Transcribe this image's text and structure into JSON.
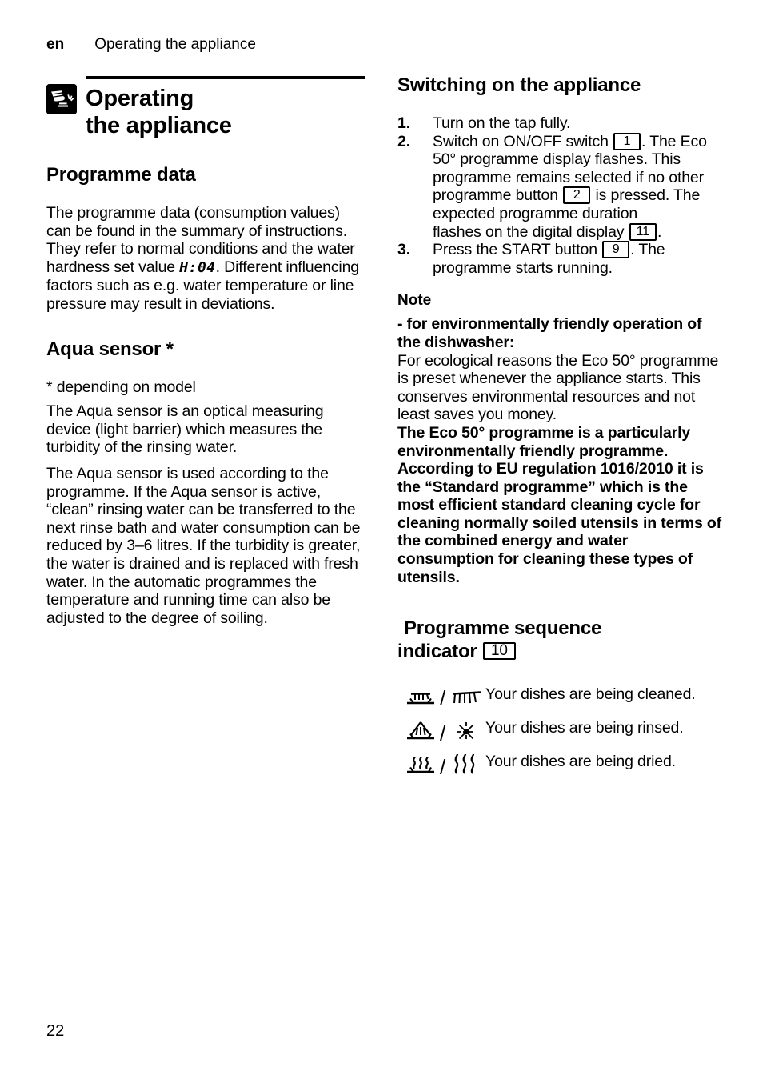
{
  "running_head": {
    "lang": "en",
    "title": "Operating the appliance"
  },
  "chapter": {
    "icon": "hand-pressing-button-icon",
    "title_line1": "Operating",
    "title_line2": "the appliance"
  },
  "left_column": {
    "programme_data": {
      "heading": "Programme data",
      "paragraph_part1": "The programme data (consumption values) can be found in the summary of instructions. They refer to normal conditions and the water hardness set value ",
      "hardness_value": "H:04",
      "paragraph_part2": ". Different influencing factors such as e.g. water temperature or line pressure may result in deviations."
    },
    "aqua_sensor": {
      "heading": "Aqua sensor *",
      "footnote": "* depending on model",
      "paragraph1": "The Aqua sensor is an optical measuring device (light barrier) which measures the turbidity of the rinsing water.",
      "paragraph2": "The Aqua sensor is used according to the programme. If the Aqua sensor is active, “clean” rinsing water can be transferred to the next rinse bath and water consumption can be reduced by 3–6 litres. If the turbidity is greater, the water is drained and is replaced with fresh water. In the automatic programmes the temperature and running time can also be adjusted to the degree of soiling."
    }
  },
  "right_column": {
    "switching_on": {
      "heading": "Switching on the appliance",
      "steps": [
        {
          "number": "1.",
          "text_before": "Turn on the tap fully.",
          "ref": "",
          "text_after": ""
        },
        {
          "number": "2.",
          "text_before": "Switch on ON/OFF switch ",
          "ref": "1",
          "text_after": ". The Eco 50° programme display flashes. This programme remains selected if no other programme button ",
          "ref2": "2",
          "text_after2": " is pressed. The expected programme duration",
          "text_line_break": "flashes on the digital display ",
          "ref3": "11",
          "text_after3": "."
        },
        {
          "number": "3.",
          "text_before": "Press the START button ",
          "ref": "9",
          "text_after": ". The programme starts running."
        }
      ]
    },
    "note": {
      "heading": "Note",
      "bold_intro": "- for environmentally friendly operation of the dishwasher:",
      "paragraph": "For ecological reasons the Eco 50° programme is preset whenever the appliance starts. This conserves environmental resources and not least saves you money.",
      "bold_paragraph": "The Eco 50° programme is a particularly environmentally friendly programme. According to EU regulation 1016/2010 it is the “Standard programme” which is the most efficient standard cleaning cycle for cleaning normally soiled utensils in terms of the combined energy and water consumption for cleaning these types of utensils."
    },
    "sequence_indicator": {
      "heading_line1": "Programme sequence",
      "heading_line2": "indicator",
      "heading_ref": "10",
      "rows": [
        {
          "symbol_left": "basin-spray-icon",
          "separator": "/",
          "symbol_right": "brush-spray-icon",
          "text": "Your dishes are being cleaned."
        },
        {
          "symbol_left": "basin-fan-spray-icon",
          "separator": "/",
          "symbol_right": "sparkle-icon",
          "text": "Your dishes are being rinsed."
        },
        {
          "symbol_left": "basin-heat-waves-icon",
          "separator": "/",
          "symbol_right": "heat-waves-icon",
          "text": "Your dishes are being dried."
        }
      ]
    }
  },
  "folio": "22",
  "colors": {
    "text": "#000000",
    "background": "#ffffff"
  }
}
